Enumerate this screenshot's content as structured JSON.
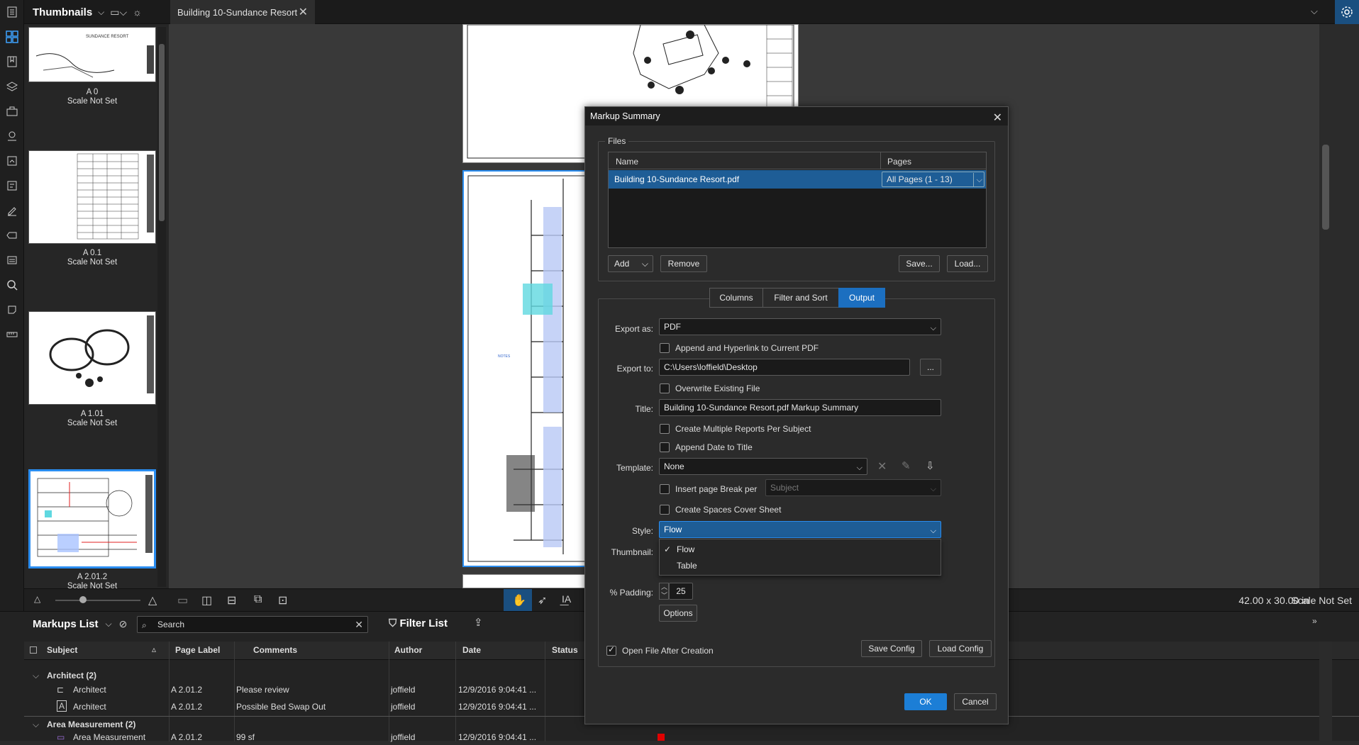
{
  "thumbnails_panel": {
    "title": "Thumbnails",
    "items": [
      {
        "label": "A 0",
        "scale": "Scale Not Set"
      },
      {
        "label": "A 0.1",
        "scale": "Scale Not Set"
      },
      {
        "label": "A 1.01",
        "scale": "Scale Not Set"
      },
      {
        "label": "A 2.01.2",
        "scale": "Scale Not Set",
        "selected": true
      }
    ]
  },
  "document_tab": {
    "title": "Building 10-Sundance Resort"
  },
  "viewer": {
    "page_size": "42.00 x 30.00 in",
    "scale": "Scale Not Set"
  },
  "markups_list": {
    "title": "Markups List",
    "search_placeholder": "Search",
    "filter_label": "Filter List",
    "columns": [
      "Subject",
      "Page Label",
      "Comments",
      "Author",
      "Date",
      "Status"
    ],
    "groups": [
      {
        "name": "Architect (2)",
        "rows": [
          {
            "subject": "Architect",
            "page": "A 2.01.2",
            "comment": "Please review",
            "author": "joffield",
            "date": "12/9/2016 9:04:41 ..."
          },
          {
            "subject": "Architect",
            "page": "A 2.01.2",
            "comment": "Possible Bed Swap Out",
            "author": "joffield",
            "date": "12/9/2016 9:04:41 ..."
          }
        ]
      },
      {
        "name": "Area Measurement (2)",
        "rows": [
          {
            "subject": "Area Measurement",
            "page": "A 2.01.2",
            "comment": "99 sf",
            "author": "joffield",
            "date": "12/9/2016 9:04:41 ..."
          }
        ]
      }
    ]
  },
  "dialog": {
    "title": "Markup Summary",
    "files_group": "Files",
    "files_columns": {
      "name": "Name",
      "pages": "Pages"
    },
    "file_row": {
      "name": "Building 10-Sundance Resort.pdf",
      "pages": "All Pages (1 - 13)"
    },
    "add_label": "Add",
    "remove_label": "Remove",
    "save_label": "Save...",
    "load_label": "Load...",
    "tabs": [
      "Columns",
      "Filter and Sort",
      "Output"
    ],
    "active_tab": "Output",
    "export_as_label": "Export as:",
    "export_as_value": "PDF",
    "append_hyperlink": "Append and Hyperlink to Current PDF",
    "export_to_label": "Export to:",
    "export_to_value": "C:\\Users\\loffield\\Desktop",
    "browse_label": "...",
    "overwrite": "Overwrite Existing File",
    "title_label": "Title:",
    "title_value": "Building 10-Sundance Resort.pdf Markup Summary",
    "multi_reports": "Create Multiple Reports Per Subject",
    "append_date": "Append Date to Title",
    "template_label": "Template:",
    "template_value": "None",
    "page_break": "Insert page Break per",
    "page_break_value": "Subject",
    "spaces_cover": "Create Spaces Cover Sheet",
    "style_label": "Style:",
    "style_value": "Flow",
    "style_options": [
      "Flow",
      "Table"
    ],
    "thumbnail_label": "Thumbnail:",
    "padding_label": "% Padding:",
    "padding_value": "25",
    "options_label": "Options",
    "open_after": "Open File After Creation",
    "save_config": "Save Config",
    "load_config": "Load Config",
    "ok": "OK",
    "cancel": "Cancel"
  }
}
